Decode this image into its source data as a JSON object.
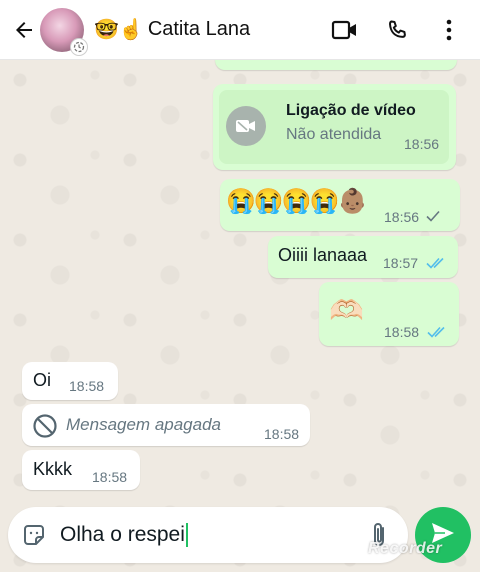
{
  "header": {
    "contact_emoji": "🤓☝",
    "contact_name": "Catita Lana",
    "icons": [
      "back-arrow-icon",
      "video-call-icon",
      "phone-icon",
      "more-vert-icon"
    ]
  },
  "messages": [
    {
      "kind": "call",
      "title": "Ligação de vídeo",
      "subtitle": "Não atendida",
      "time": "18:56"
    },
    {
      "kind": "outgoing",
      "text": "😭😭😭😭👶🏽",
      "time": "18:56",
      "status": "sent"
    },
    {
      "kind": "outgoing",
      "text": "Oiiii lanaaa",
      "time": "18:57",
      "status": "read"
    },
    {
      "kind": "outgoing",
      "text": "🫶🏻",
      "time": "18:58",
      "status": "read"
    },
    {
      "kind": "incoming",
      "text": "Oi",
      "time": "18:58"
    },
    {
      "kind": "incoming-deleted",
      "text": "Mensagem apagada",
      "time": "18:58"
    },
    {
      "kind": "incoming",
      "text": "Kkkk",
      "time": "18:58"
    }
  ],
  "composer": {
    "value": "Olha o respei",
    "icons": [
      "sticker-icon",
      "attach-icon",
      "send-icon"
    ]
  },
  "watermark": "Recorder",
  "colors": {
    "outgoing_bubble": "#d9fdd3",
    "incoming_bubble": "#ffffff",
    "read_ticks": "#53bdeb",
    "send_button": "#21c063",
    "background": "#efeae2"
  }
}
